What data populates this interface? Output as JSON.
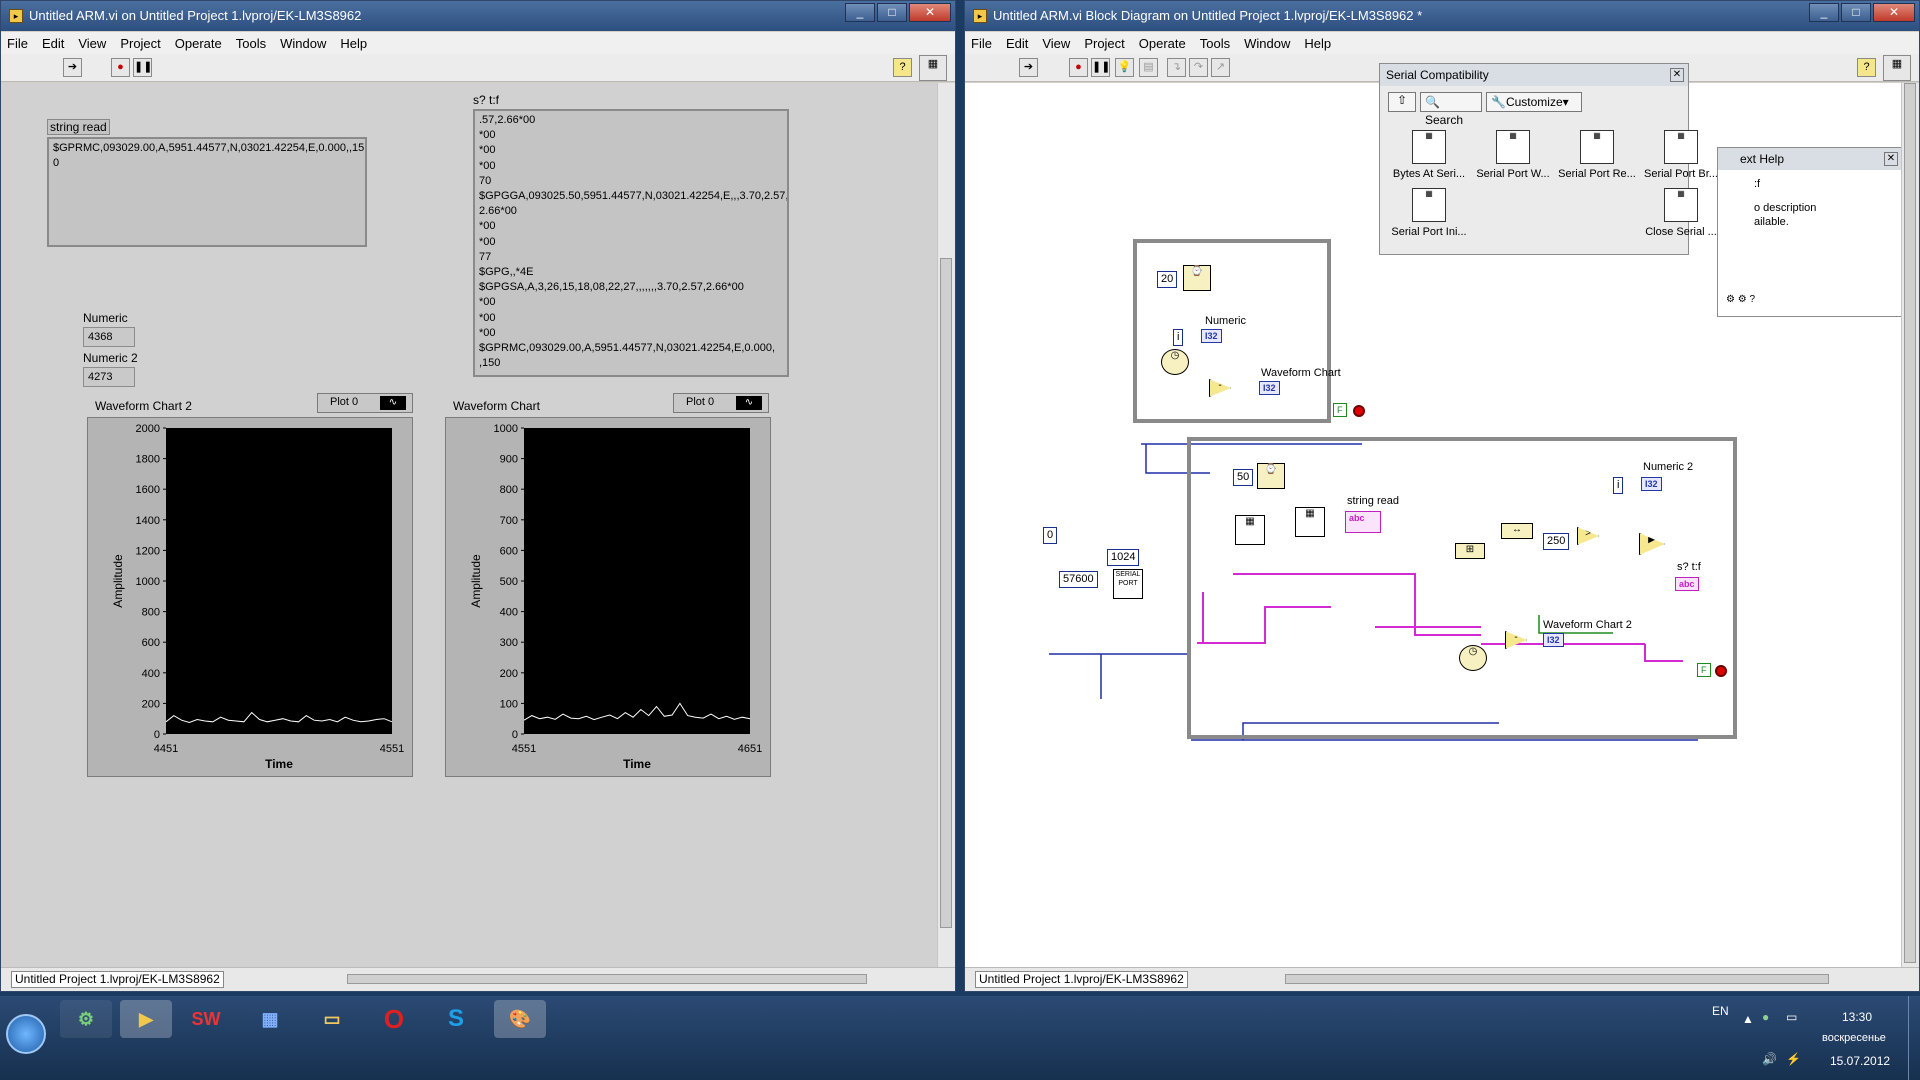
{
  "front_panel": {
    "title": "Untitled ARM.vi on Untitled Project 1.lvproj/EK-LM3S8962",
    "menu": [
      "File",
      "Edit",
      "View",
      "Project",
      "Operate",
      "Tools",
      "Window",
      "Help"
    ],
    "string_read": {
      "label": "string read",
      "value": "$GPRMC,093029.00,A,5951.44577,N,03021.42254,E,0.000,,15\n0"
    },
    "stf": {
      "label": "s? t:f",
      "value": ".57,2.66*00\n*00\n*00\n*00\n70\n$GPGGA,093025.50,5951.44577,N,03021.42254,E,,,3.70,2.57,\n2.66*00\n*00\n*00\n77\n$GPG,,*4E\n$GPGSA,A,3,26,15,18,08,22,27,,,,,,,3.70,2.57,2.66*00\n*00\n*00\n*00\n$GPRMC,093029.00,A,5951.44577,N,03021.42254,E,0.000,\n,150"
    },
    "numeric": {
      "label": "Numeric",
      "value": "4368"
    },
    "numeric2": {
      "label": "Numeric 2",
      "value": "4273"
    },
    "status_path": "Untitled Project 1.lvproj/EK-LM3S8962"
  },
  "chart_data": [
    {
      "type": "line",
      "title": "Waveform Chart 2",
      "legend": "Plot 0",
      "xlabel": "Time",
      "ylabel": "Amplitude",
      "xlim": [
        4451,
        4551
      ],
      "ylim": [
        0,
        2000
      ],
      "yticks": [
        "2000",
        "1800",
        "1600",
        "1400",
        "1200",
        "1000",
        "800",
        "600",
        "400",
        "200",
        "0"
      ],
      "xticks": [
        "4451",
        "4551"
      ],
      "series": [
        {
          "values": [
            80,
            120,
            90,
            75,
            95,
            85,
            80,
            110,
            90,
            85,
            80,
            140,
            95,
            80,
            90,
            100,
            85,
            80,
            120,
            90,
            85,
            95,
            80,
            110,
            90,
            80,
            85,
            95,
            100,
            80
          ]
        }
      ]
    },
    {
      "type": "line",
      "title": "Waveform Chart",
      "legend": "Plot 0",
      "xlabel": "Time",
      "ylabel": "Amplitude",
      "xlim": [
        4551,
        4651
      ],
      "ylim": [
        0,
        1000
      ],
      "yticks": [
        "1000",
        "900",
        "800",
        "700",
        "600",
        "500",
        "400",
        "300",
        "200",
        "100",
        "0"
      ],
      "xticks": [
        "4551",
        "4651"
      ],
      "series": [
        {
          "values": [
            45,
            60,
            50,
            55,
            48,
            65,
            52,
            50,
            58,
            47,
            55,
            62,
            50,
            70,
            55,
            80,
            60,
            90,
            58,
            62,
            100,
            60,
            55,
            52,
            65,
            50,
            58,
            48,
            55,
            50
          ]
        }
      ]
    }
  ],
  "block_diagram": {
    "title": "Untitled ARM.vi Block Diagram on Untitled Project 1.lvproj/EK-LM3S8962 *",
    "menu": [
      "File",
      "Edit",
      "View",
      "Project",
      "Operate",
      "Tools",
      "Window",
      "Help"
    ],
    "status_path": "Untitled Project 1.lvproj/EK-LM3S8962",
    "palette": {
      "title": "Serial Compatibility",
      "search": "Search",
      "customize": "Customize",
      "items": [
        "Bytes At Seri...",
        "Serial Port W...",
        "Serial Port Re...",
        "Serial Port Br...",
        "Serial Port Ini...",
        "Close Serial ..."
      ]
    },
    "context_help": {
      "title": "ext Help",
      "line1": ":f",
      "line2": "o description",
      "line3": "ailable."
    },
    "loop1": {
      "wait_const": "20",
      "numeric_label": "Numeric",
      "chart_label": "Waveform Chart",
      "i32": "I32",
      "i": "i",
      "f": "F"
    },
    "loop2": {
      "wait_const": "50",
      "numeric2_label": "Numeric 2",
      "string_label": "string read",
      "stf_label": "s? t:f",
      "chart2_label": "Waveform Chart 2",
      "const250": "250",
      "i32": "I32",
      "i": "i",
      "f": "F"
    },
    "outside": {
      "const0": "0",
      "const1024": "1024",
      "baud": "57600"
    }
  },
  "taskbar": {
    "lang": "EN",
    "time": "13:30",
    "day": "воскресенье",
    "date": "15.07.2012"
  }
}
